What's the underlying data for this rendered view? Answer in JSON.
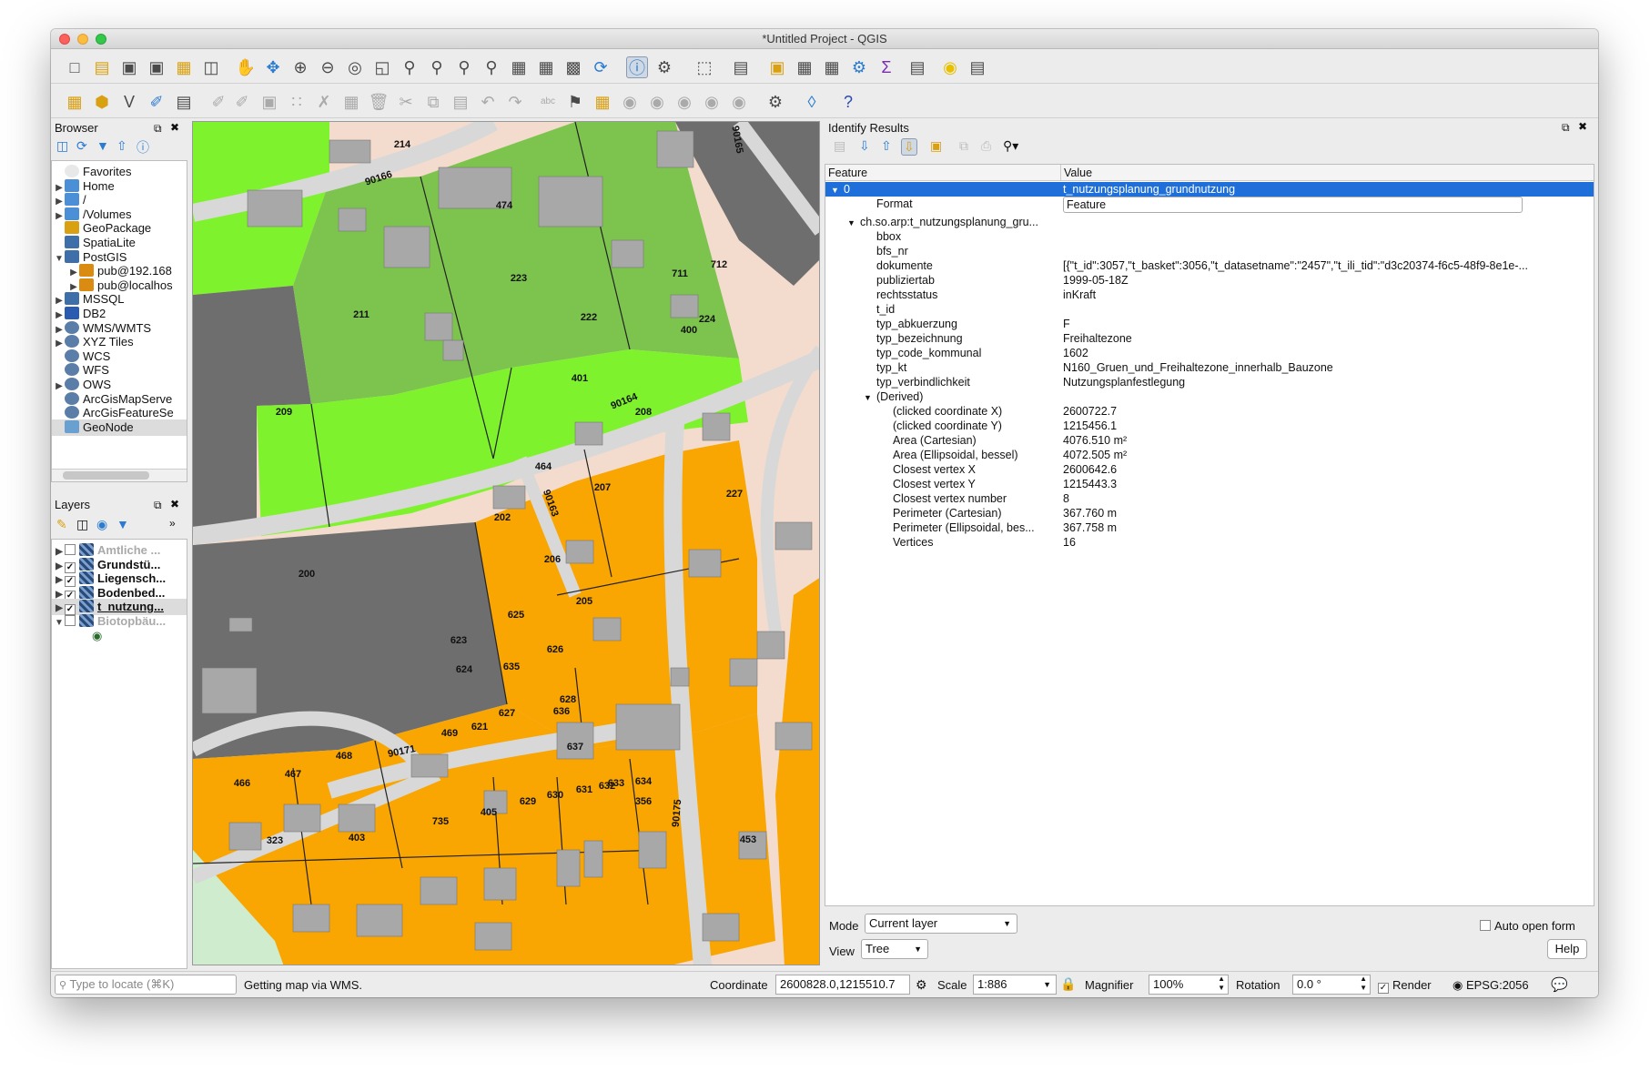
{
  "window": {
    "title": "*Untitled Project - QGIS"
  },
  "browser": {
    "title": "Browser",
    "items": [
      {
        "label": "Favorites",
        "icon": "star-icon"
      },
      {
        "label": "Home",
        "icon": "folder-icon"
      },
      {
        "label": "/",
        "icon": "folder-icon"
      },
      {
        "label": "/Volumes",
        "icon": "folder-icon"
      },
      {
        "label": "GeoPackage",
        "icon": "geopackage-icon"
      },
      {
        "label": "SpatiaLite",
        "icon": "feather-icon"
      },
      {
        "label": "PostGIS",
        "icon": "elephant-icon"
      },
      {
        "label": "pub@192.168",
        "icon": "connection-icon"
      },
      {
        "label": "pub@localhos",
        "icon": "connection-icon"
      },
      {
        "label": "MSSQL",
        "icon": "database-icon"
      },
      {
        "label": "DB2",
        "icon": "db2-icon"
      },
      {
        "label": "WMS/WMTS",
        "icon": "globe-icon"
      },
      {
        "label": "XYZ Tiles",
        "icon": "globe-icon"
      },
      {
        "label": "WCS",
        "icon": "globe-icon"
      },
      {
        "label": "WFS",
        "icon": "globe-icon"
      },
      {
        "label": "OWS",
        "icon": "globe-icon"
      },
      {
        "label": "ArcGisMapServe",
        "icon": "globe-icon"
      },
      {
        "label": "ArcGisFeatureSe",
        "icon": "globe-icon"
      },
      {
        "label": "GeoNode",
        "icon": "geonode-icon"
      }
    ]
  },
  "layers": {
    "title": "Layers",
    "items": [
      {
        "label": "Amtliche ...",
        "checked": false
      },
      {
        "label": "Grundstü...",
        "checked": true
      },
      {
        "label": "Liegensch...",
        "checked": true
      },
      {
        "label": "Bodenbed...",
        "checked": true
      },
      {
        "label": "t_nutzung...",
        "checked": true
      },
      {
        "label": "Biotopbäu...",
        "checked": false
      }
    ]
  },
  "map": {
    "labels": [
      "214",
      "474",
      "90166",
      "90165",
      "223",
      "211",
      "222",
      "711",
      "712",
      "224",
      "400",
      "401",
      "209",
      "90164",
      "208",
      "464",
      "207",
      "202",
      "227",
      "206",
      "200",
      "205",
      "625",
      "623",
      "626",
      "624",
      "635",
      "628",
      "627",
      "636",
      "469",
      "621",
      "468",
      "90171",
      "637",
      "466",
      "467",
      "633",
      "634",
      "631",
      "632",
      "630",
      "629",
      "735",
      "405",
      "356",
      "90175",
      "323",
      "403",
      "453",
      "90163"
    ]
  },
  "identify": {
    "title": "Identify Results",
    "col_feature": "Feature",
    "col_value": "Value",
    "rows": [
      {
        "key": "0",
        "value": "t_nutzungsplanung_grundnutzung"
      },
      {
        "key": "Format",
        "value": "Feature"
      },
      {
        "key": "ch.so.arp:t_nutzungsplanung_gru...",
        "value": ""
      },
      {
        "key": "bbox",
        "value": ""
      },
      {
        "key": "bfs_nr",
        "value": ""
      },
      {
        "key": "dokumente",
        "value": "[{\"t_id\":3057,\"t_basket\":3056,\"t_datasetname\":\"2457\",\"t_ili_tid\":\"d3c20374-f6c5-48f9-8e1e-..."
      },
      {
        "key": "publiziertab",
        "value": "1999-05-18Z"
      },
      {
        "key": "rechtsstatus",
        "value": "inKraft"
      },
      {
        "key": "t_id",
        "value": ""
      },
      {
        "key": "typ_abkuerzung",
        "value": "F"
      },
      {
        "key": "typ_bezeichnung",
        "value": "Freihaltezone"
      },
      {
        "key": "typ_code_kommunal",
        "value": "1602"
      },
      {
        "key": "typ_kt",
        "value": "N160_Gruen_und_Freihaltezone_innerhalb_Bauzone"
      },
      {
        "key": "typ_verbindlichkeit",
        "value": "Nutzungsplanfestlegung"
      },
      {
        "key": "(Derived)",
        "value": ""
      },
      {
        "key": "(clicked coordinate X)",
        "value": "2600722.7"
      },
      {
        "key": "(clicked coordinate Y)",
        "value": "1215456.1"
      },
      {
        "key": "Area (Cartesian)",
        "value": "4076.510 m²"
      },
      {
        "key": "Area (Ellipsoidal, bessel)",
        "value": "4072.505 m²"
      },
      {
        "key": "Closest vertex X",
        "value": "2600642.6"
      },
      {
        "key": "Closest vertex Y",
        "value": "1215443.3"
      },
      {
        "key": "Closest vertex number",
        "value": "8"
      },
      {
        "key": "Perimeter (Cartesian)",
        "value": "367.760 m"
      },
      {
        "key": "Perimeter (Ellipsoidal, bes...",
        "value": "367.758 m"
      },
      {
        "key": "Vertices",
        "value": "16"
      }
    ],
    "mode_label": "Mode",
    "mode_value": "Current layer",
    "view_label": "View",
    "view_value": "Tree",
    "auto_open": "Auto open form",
    "help": "Help"
  },
  "status": {
    "locate_placeholder": "Type to locate (⌘K)",
    "message": "Getting map via WMS.",
    "coordinate_label": "Coordinate",
    "coordinate_value": "2600828.0,1215510.7",
    "scale_label": "Scale",
    "scale_value": "1:886",
    "magnifier_label": "Magnifier",
    "magnifier_value": "100%",
    "rotation_label": "Rotation",
    "rotation_value": "0.0 °",
    "render_label": "Render",
    "crs": "EPSG:2056"
  },
  "colors": {
    "orange": "#f9a502",
    "green_light": "#7ff22e",
    "green_mid": "#7dc44e",
    "dark_gray": "#6e6e6e",
    "building": "#a8a8a8",
    "pink": "#f3dccd",
    "selection": "#1e6fd9"
  }
}
